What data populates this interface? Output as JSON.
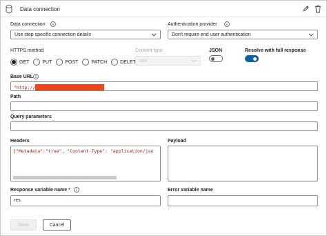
{
  "header": {
    "title": "Data connection"
  },
  "data_connection": {
    "label": "Data connection",
    "value": "Use step specific connection details"
  },
  "auth_provider": {
    "label": "Authentication provider",
    "value": "Don't require end user authentication"
  },
  "https_method": {
    "label": "HTTPS method",
    "options": [
      "GET",
      "PUT",
      "POST",
      "PATCH",
      "DELETE"
    ],
    "selected": "GET"
  },
  "content_type": {
    "label": "Content type",
    "value": "raw"
  },
  "json_toggle": {
    "label": "JSON",
    "on": false
  },
  "resolve_toggle": {
    "label": "Resolve with full response",
    "on": true
  },
  "base_url": {
    "label": "Base URL",
    "value": "\"http://"
  },
  "path": {
    "label": "Path",
    "value": ""
  },
  "query_parameters": {
    "label": "Query parameters",
    "value": ""
  },
  "headers": {
    "label": "Headers",
    "value": "{\"Metadata\":\"true\", \"Content-Type\": \"application/jso"
  },
  "payload": {
    "label": "Payload",
    "value": ""
  },
  "response_variable": {
    "label": "Response variable name",
    "required_mark": "*",
    "value": "res"
  },
  "error_variable": {
    "label": "Error variable name",
    "value": ""
  },
  "footer": {
    "save_label": "Save",
    "cancel_label": "Cancel"
  }
}
